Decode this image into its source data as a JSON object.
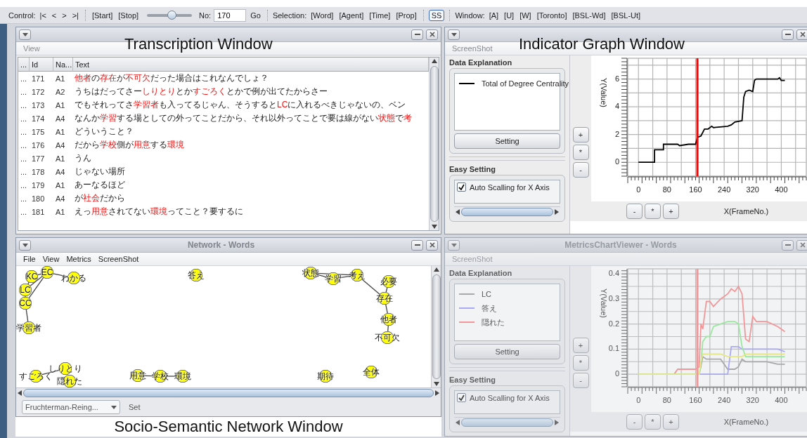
{
  "toolbar": {
    "control_label": "Control:",
    "nav_buttons": [
      "|<",
      "<",
      ">",
      ">|"
    ],
    "play_buttons": [
      "[Start]",
      "[Stop]"
    ],
    "slider": {
      "level": 0.55
    },
    "frame_label": "No:",
    "frame_value": "170",
    "go_button": "Go",
    "selection_label": "Selection:",
    "selection_buttons": [
      "[Word]",
      "[Agent]",
      "[Time]",
      "[Prop]"
    ],
    "ss_button": {
      "label": "SS",
      "selected": true
    },
    "window_label": "Window:",
    "window_buttons": [
      "[A]",
      "[U]",
      "[W]",
      "[Toronto]",
      "[BSL-Wd]",
      "[BSL-Ut]"
    ]
  },
  "transcription_window": {
    "menu": [
      "View"
    ],
    "columns": [
      "...",
      "Id",
      "Na...",
      "Text"
    ],
    "rows": [
      {
        "mark": "...",
        "id": "171",
        "name": "A1",
        "text": [
          {
            "text": "他者",
            "highlighted": true
          },
          {
            "text": "の",
            "highlighted": false
          },
          {
            "text": "存在",
            "highlighted": true
          },
          {
            "text": "が",
            "highlighted": false
          },
          {
            "text": "不可欠",
            "highlighted": true
          },
          {
            "text": "だった場合はこれなんでしょ？",
            "highlighted": false
          }
        ]
      },
      {
        "mark": "...",
        "id": "172",
        "name": "A2",
        "text": [
          {
            "text": "うちはだってさー",
            "highlighted": false
          },
          {
            "text": "しりとり",
            "highlighted": true
          },
          {
            "text": "とか",
            "highlighted": false
          },
          {
            "text": "すごろく",
            "highlighted": true
          },
          {
            "text": "とかで例が出てたからさー",
            "highlighted": false
          }
        ]
      },
      {
        "mark": "...",
        "id": "173",
        "name": "A1",
        "text": [
          {
            "text": "でもそれってさ",
            "highlighted": false
          },
          {
            "text": "学習者",
            "highlighted": true
          },
          {
            "text": "も入ってるじゃん、そうすると",
            "highlighted": false
          },
          {
            "text": "LC",
            "highlighted": true
          },
          {
            "text": "に入れるべきじゃないの、ベン",
            "highlighted": false
          }
        ]
      },
      {
        "mark": "...",
        "id": "174",
        "name": "A4",
        "text": [
          {
            "text": "なんか",
            "highlighted": false
          },
          {
            "text": "学習",
            "highlighted": true
          },
          {
            "text": "する場としての外ってことだから、それ以外ってことで要は線がない",
            "highlighted": false
          },
          {
            "text": "状態",
            "highlighted": true
          },
          {
            "text": "で",
            "highlighted": false
          },
          {
            "text": "考",
            "highlighted": true
          }
        ]
      },
      {
        "mark": "...",
        "id": "175",
        "name": "A1",
        "text": [
          {
            "text": "どういうこと？",
            "highlighted": false
          }
        ]
      },
      {
        "mark": "...",
        "id": "176",
        "name": "A4",
        "text": [
          {
            "text": "だから",
            "highlighted": false
          },
          {
            "text": "学校",
            "highlighted": true
          },
          {
            "text": "側が",
            "highlighted": false
          },
          {
            "text": "用意",
            "highlighted": true
          },
          {
            "text": "する",
            "highlighted": false
          },
          {
            "text": "環境",
            "highlighted": true
          }
        ]
      },
      {
        "mark": "...",
        "id": "177",
        "name": "A1",
        "text": [
          {
            "text": "うん",
            "highlighted": false
          }
        ]
      },
      {
        "mark": "...",
        "id": "178",
        "name": "A4",
        "text": [
          {
            "text": "じゃない場所",
            "highlighted": false
          }
        ]
      },
      {
        "mark": "...",
        "id": "179",
        "name": "A1",
        "text": [
          {
            "text": "あーなるほど",
            "highlighted": false
          }
        ]
      },
      {
        "mark": "...",
        "id": "180",
        "name": "A4",
        "text": [
          {
            "text": "が",
            "highlighted": false
          },
          {
            "text": "社会",
            "highlighted": true
          },
          {
            "text": "だから",
            "highlighted": false
          }
        ]
      },
      {
        "mark": "...",
        "id": "181",
        "name": "A1",
        "text": [
          {
            "text": "えっ",
            "highlighted": false
          },
          {
            "text": "用意",
            "highlighted": true
          },
          {
            "text": "されてない",
            "highlighted": false
          },
          {
            "text": "環境",
            "highlighted": true
          },
          {
            "text": "ってこと？要するに",
            "highlighted": false
          }
        ]
      }
    ]
  },
  "indicator_window": {
    "active": true,
    "menu": [
      "ScreenShot"
    ],
    "explanation_title": "Data Explanation",
    "setting_button": "Setting",
    "easy_setting_title": "Easy Setting",
    "options": [
      {
        "label": "Auto Scalling for X Axis",
        "checked": true
      }
    ],
    "y_buttons": [
      "+",
      "*",
      "-"
    ],
    "x_buttons": [
      "-",
      "*",
      "+"
    ],
    "chart_data": {
      "type": "line",
      "xlabel": "X(FrameNo.)",
      "ylabel": "Y(Value)",
      "x": [
        0,
        45,
        45,
        70,
        70,
        110,
        115,
        140,
        160,
        165,
        175,
        185,
        195,
        205,
        210,
        250,
        260,
        270,
        290,
        295,
        300,
        310,
        320,
        325,
        330,
        390,
        395,
        400,
        410
      ],
      "series": [
        {
          "name": "Total of Degree Centrality",
          "color": "#000000",
          "values": [
            0,
            0,
            0.9,
            0.9,
            1.3,
            1.3,
            1.2,
            1.3,
            1.3,
            1.8,
            1.9,
            2.4,
            2.4,
            2.6,
            2.5,
            2.6,
            2.7,
            2.9,
            3.0,
            4.7,
            5.1,
            5.2,
            5.1,
            5.9,
            6.0,
            6.0,
            6.1,
            5.9,
            5.9
          ]
        }
      ],
      "xlim": [
        -30,
        470
      ],
      "ylim": [
        -1,
        7.5
      ],
      "xticks": [
        0,
        80,
        160,
        240,
        320,
        400
      ],
      "yticks": [
        0,
        2,
        4,
        6
      ],
      "grid": true,
      "ref_lines": [
        {
          "axis": "x",
          "value": 165,
          "color": "#ff0000"
        }
      ]
    }
  },
  "network_window": {
    "title": "Network - Words",
    "menu": [
      "File",
      "View",
      "Metrics",
      "ScreenShot"
    ],
    "nodes": [
      "KC",
      "EC",
      "わかる",
      "LC",
      "CC",
      "学習者",
      "答え",
      "状態",
      "学習",
      "考え",
      "必要",
      "存在",
      "他者",
      "不可欠",
      "すごろく",
      "しりとり",
      "隠れた",
      "用意",
      "学校",
      "環境",
      "期待",
      "全体"
    ],
    "layout_select": "Fruchterman-Reing...",
    "set_button": "Set"
  },
  "metrics_window": {
    "active": false,
    "title": "MetricsChartViewer - Words",
    "menu": [
      "ScreenShot"
    ],
    "explanation_title": "Data Explanation",
    "setting_button": "Setting",
    "easy_setting_title": "Easy Setting",
    "options": [
      {
        "label": "Auto Scalling for X Axis",
        "checked": true
      }
    ],
    "y_buttons": [
      "+",
      "*",
      "-"
    ],
    "x_buttons": [
      "-",
      "*",
      "+"
    ],
    "chart_data": {
      "type": "line",
      "xlabel": "X(FrameNo.)",
      "ylabel": "Y(Value)",
      "x": [
        0,
        100,
        110,
        150,
        160,
        170,
        175,
        180,
        190,
        200,
        210,
        230,
        250,
        260,
        270,
        280,
        290,
        300,
        310,
        320,
        330,
        360,
        390,
        410
      ],
      "series": [
        {
          "name": "LC",
          "color": "#999999",
          "values": [
            0,
            0,
            0,
            0,
            0,
            0,
            0.03,
            0.07,
            0.06,
            0.06,
            0.06,
            0.06,
            0.02,
            0.02,
            0.02,
            0.03,
            0.06,
            0.05,
            0.05,
            0.05,
            0.05,
            0.05,
            0.04,
            0.04
          ]
        },
        {
          "name": "答え",
          "color": "#9999ff",
          "values": [
            0,
            0,
            0,
            0,
            0,
            0,
            0,
            0,
            0,
            0,
            0,
            0,
            0,
            0.11,
            0.11,
            0.11,
            0.1,
            0.1,
            0.1,
            0.1,
            0.1,
            0.1,
            0.1,
            0.09
          ]
        },
        {
          "name": "隠れた",
          "color": "#ff8080",
          "values": [
            0,
            0,
            0.02,
            0.02,
            0.02,
            0.03,
            0.2,
            0.18,
            0.29,
            0.29,
            0.27,
            0.3,
            0.32,
            0.34,
            0.33,
            0.35,
            0.32,
            0.14,
            0.13,
            0.23,
            0.21,
            0.21,
            0.19,
            0.17
          ]
        },
        {
          "color": "#88ee88",
          "values": [
            0,
            0,
            0,
            0,
            0,
            0,
            0.04,
            0.13,
            0.15,
            0.15,
            0.19,
            0.2,
            0.21,
            0.21,
            0.21,
            0.2,
            0.11,
            0.07,
            0.07,
            0.07,
            0.07,
            0.07,
            0.07,
            0.07
          ]
        },
        {
          "color": "#eeee66",
          "values": [
            0,
            0,
            0,
            0,
            0,
            0,
            0.05,
            0.08,
            0.08,
            0.08,
            0.08,
            0.08,
            0.07,
            0.07,
            0.07,
            0.07,
            0.07,
            0.08,
            0.08,
            0.08,
            0.08,
            0.08,
            0.08,
            0.08
          ]
        }
      ],
      "xlim": [
        -30,
        470
      ],
      "ylim": [
        -0.05,
        0.42
      ],
      "xticks": [
        0,
        80,
        160,
        240,
        320,
        400
      ],
      "yticks": [
        0,
        0.1,
        0.2,
        0.3,
        0.4
      ],
      "grid": true,
      "ref_lines": [
        {
          "axis": "x",
          "value": 165,
          "color": "#ff8080"
        }
      ]
    }
  },
  "figure_labels": [
    "Transcription Window",
    "Indicator Graph Window",
    "Socio-Semantic Network Window"
  ]
}
